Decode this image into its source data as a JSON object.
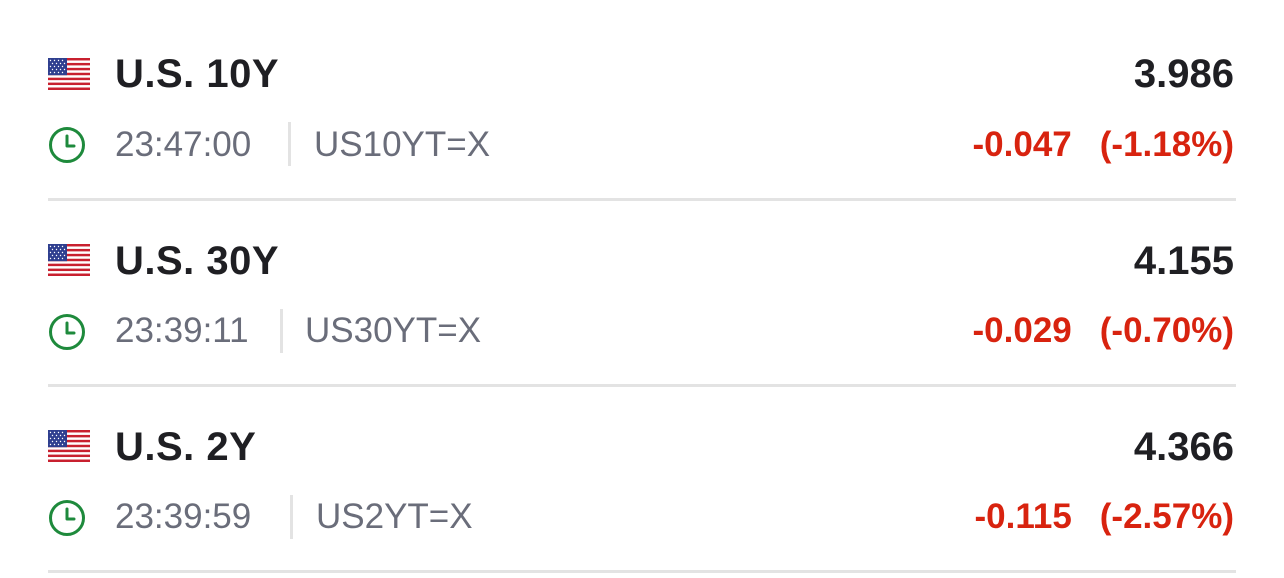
{
  "quotes": [
    {
      "flag_icon": "us-flag-icon",
      "name": "U.S. 10Y",
      "price": "3.986",
      "time": "23:47:00",
      "ticker": "US10YT=X",
      "change": "-0.047",
      "change_pct": "(-1.18%)"
    },
    {
      "flag_icon": "us-flag-icon",
      "name": "U.S. 30Y",
      "price": "4.155",
      "time": "23:39:11",
      "ticker": "US30YT=X",
      "change": "-0.029",
      "change_pct": "(-0.70%)"
    },
    {
      "flag_icon": "us-flag-icon",
      "name": "U.S. 2Y",
      "price": "4.366",
      "time": "23:39:59",
      "ticker": "US2YT=X",
      "change": "-0.115",
      "change_pct": "(-2.57%)"
    }
  ],
  "colors": {
    "negative": "#d8230f",
    "clock": "#1e8a3c",
    "muted_text": "#6a6d7a",
    "divider": "#e3e3e3"
  }
}
